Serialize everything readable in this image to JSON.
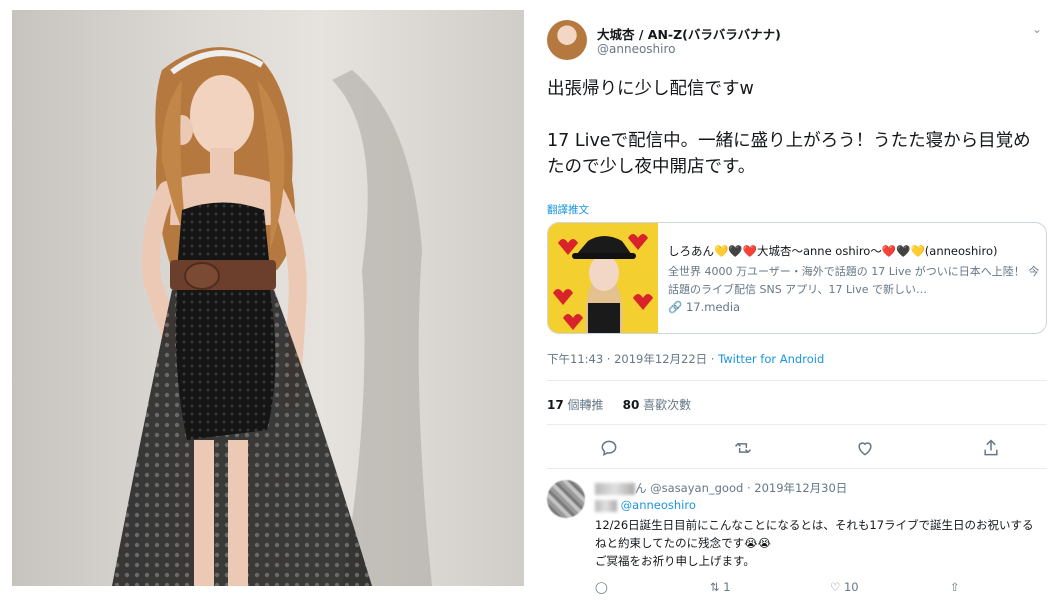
{
  "tweet": {
    "author_name": "大城杏 / AN-Z(バラバラバナナ)",
    "author_handle": "@anneoshiro",
    "body_line1": "出張帰りに少し配信ですw",
    "body_line2": "17 Liveで配信中。一緒に盛り上がろう！うたた寝から目覚めたので少し夜中開店です。",
    "translate_label": "翻譯推文",
    "card": {
      "title": "しろあん💛🖤❤️大城杏～anne oshiro～❤️🖤💛(anneoshiro)",
      "description": "全世界 4000 万ユーザー・海外で話題の 17 Live がついに日本へ上陸！ 今話題のライブ配信 SNS アプリ、17 Live で新しい…",
      "link": "17.media",
      "link_icon": "link-icon"
    },
    "timestamp": "下午11:43 · 2019年12月22日 · ",
    "source_app": "Twitter for Android",
    "retweet_count": "17",
    "retweet_label": " 個轉推",
    "like_count": "80",
    "like_label": " 喜歡次數",
    "action_icons": [
      "reply-icon",
      "retweet-icon",
      "like-icon",
      "share-icon"
    ]
  },
  "reply": {
    "name_suffix": "ん",
    "handle_date": "@sasayan_good · 2019年12月30日",
    "replying_to": "@anneoshiro",
    "text_line1": "12/26日誕生日目前にこんなことになるとは、それも17ライブで誕生日のお祝いするねと約束してたのに残念です😭😭",
    "text_line2": "ご冥福をお祈り申し上げます。",
    "retweet_count": "1",
    "like_count": "10"
  },
  "colors": {
    "link_blue": "#1b95e0",
    "muted_gray": "#657786",
    "border": "#ccd6dd"
  }
}
